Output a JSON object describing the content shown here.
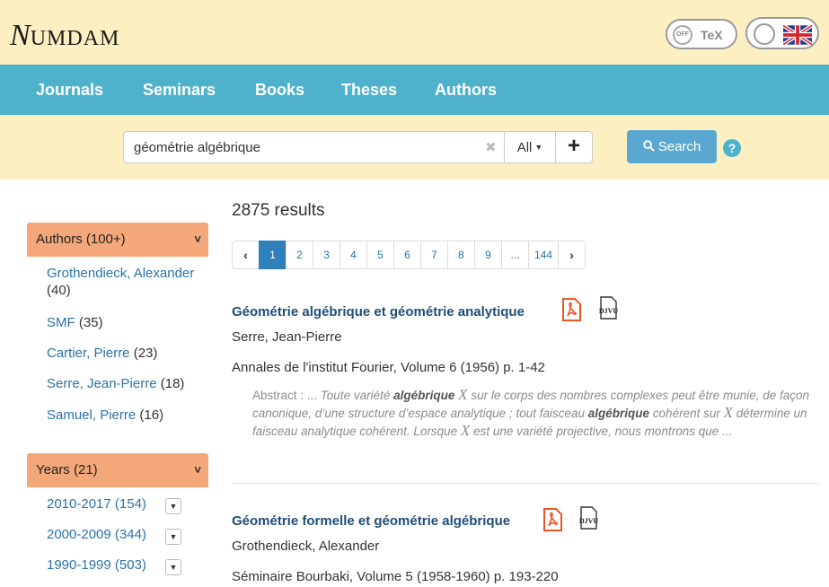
{
  "header": {
    "logo_initial": "N",
    "logo_rest": "UMDAM",
    "tex_toggle": {
      "state_label": "OFF",
      "label": "TeX"
    },
    "language_toggle": {
      "flag": "uk-flag-icon"
    }
  },
  "nav": {
    "items": [
      {
        "label": "Journals"
      },
      {
        "label": "Seminars"
      },
      {
        "label": "Books"
      },
      {
        "label": "Theses"
      },
      {
        "label": "Authors"
      }
    ]
  },
  "search": {
    "query": "géométrie algébrique",
    "clear_icon": "✖",
    "scope_label": "All",
    "add_label": "+",
    "button_label": "Search",
    "help_label": "?"
  },
  "sidebar": {
    "authors": {
      "header": "Authors (100+)",
      "items": [
        {
          "name": "Grothendieck, Alexander",
          "count": "(40)"
        },
        {
          "name": "SMF",
          "count": "(35)"
        },
        {
          "name": "Cartier, Pierre",
          "count": "(23)"
        },
        {
          "name": "Serre, Jean-Pierre",
          "count": "(18)"
        },
        {
          "name": "Samuel, Pierre",
          "count": "(16)"
        }
      ]
    },
    "years": {
      "header": "Years (21)",
      "items": [
        {
          "label": "2010-2017 (154)"
        },
        {
          "label": "2000-2009 (344)"
        },
        {
          "label": "1990-1999 (503)"
        }
      ]
    }
  },
  "main": {
    "results_count": "2875 results",
    "pagination": {
      "prev": "‹",
      "pages": [
        "1",
        "2",
        "3",
        "4",
        "5",
        "6",
        "7",
        "8",
        "9",
        "...",
        "144"
      ],
      "active": "1",
      "next": "›"
    },
    "results": [
      {
        "title": "Géométrie algébrique et géométrie analytique",
        "author": "Serre, Jean-Pierre",
        "source": "Annales de l'institut Fourier, Volume 6 (1956) p. 1-42",
        "abstract": {
          "label": "Abstract : ...",
          "p1": "Toute variété",
          "h1": "algébrique",
          "m1": "X",
          "p2": "sur le corps des nombres complexes peut être munie, de façon canonique, d’une structure d’espace analytique ; tout faisceau",
          "h2": "algébrique",
          "p3": "cohérent sur",
          "m2": "X",
          "p4": "détermine un faisceau analytique cohérent. Lorsque",
          "m3": "X",
          "p5": "est une variété projective, nous montrons que ..."
        }
      },
      {
        "title": "Géométrie formelle et géométrie algébrique",
        "author": "Grothendieck, Alexander",
        "source": "Séminaire Bourbaki, Volume 5 (1958-1960) p. 193-220"
      }
    ],
    "djvu_label": "DJVU"
  },
  "colors": {
    "header_bg": "#fcefc2",
    "nav_bg": "#4fb2cc",
    "facet_header_bg": "#f4a779",
    "link": "#2a73a8",
    "title": "#1f4e79",
    "pdf_red": "#e8562a"
  }
}
